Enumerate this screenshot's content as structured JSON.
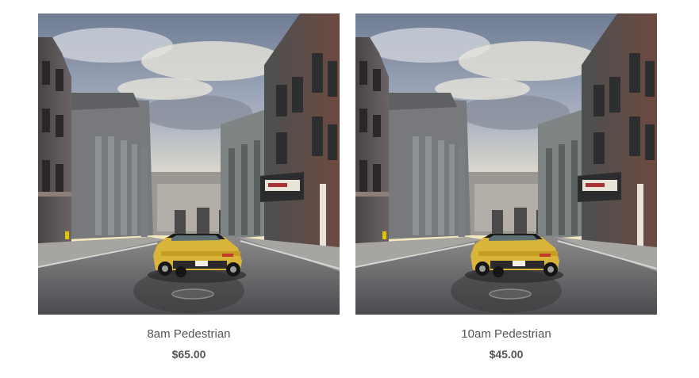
{
  "products": [
    {
      "title": "8am Pedestrian",
      "price": "$65.00",
      "image_label": "street-scene-photo"
    },
    {
      "title": "10am Pedestrian",
      "price": "$45.00",
      "image_label": "street-scene-photo"
    }
  ],
  "colors": {
    "text": "#555555",
    "background": "#ffffff",
    "car": "#d8b43a"
  }
}
